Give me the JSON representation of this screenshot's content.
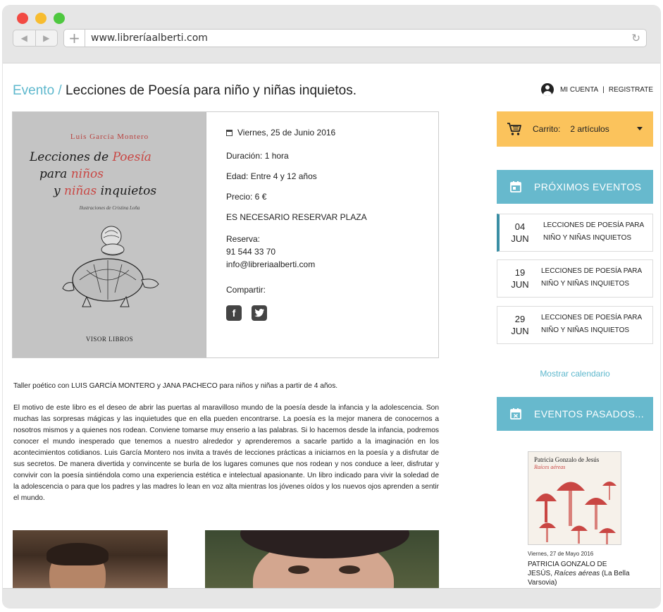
{
  "browser": {
    "url": "www.libreríaalberti.com"
  },
  "header": {
    "crumb": "Evento /",
    "title": "Lecciones de Poesía para niño y niñas inquietos.",
    "account_label": "MI CUENTA",
    "separator": "|",
    "register_label": "REGISTRATE"
  },
  "cover": {
    "author": "Luis García Montero",
    "title_line1_a": "Lecciones de ",
    "title_line1_b": "Poesía",
    "title_line2_a": "para ",
    "title_line2_b": "niños",
    "title_line3_a": "y ",
    "title_line3_b": "niñas",
    "title_line3_c": " inquietos",
    "illustrations": "Ilustraciones de Cristina Loña",
    "publisher": "VISOR LIBROS"
  },
  "event": {
    "date": "Viernes, 25 de Junio 2016",
    "duration": "Duración: 1 hora",
    "age": "Edad: Entre 4 y 12 años",
    "price": "Precio: 6 €",
    "notice": "ES NECESARIO RESERVAR PLAZA",
    "booking_label": "Reserva:",
    "phone": "91 544 33 70",
    "email": "info@libreriaalberti.com",
    "share_label": "Compartir:"
  },
  "body": {
    "intro": "Taller poético  con LUIS GARCÍA MONTERO y JANA PACHECO para niños y niñas a partir de 4 años.",
    "description": "El motivo de este libro es el deseo de abrir las puertas al maravilloso mundo de la poesía desde la infancia y la adolescencia. Son muchas las sorpresas mágicas y las inquietudes que en ella pueden encontrarse. La poesía es la mejor manera de conocernos a nosotros mismos y a quienes nos rodean.  Conviene tomarse muy enserio a las palabras. Si lo hacemos desde la infancia, podremos conocer el mundo inesperado que tenemos a nuestro alrededor y aprenderemos a sacarle partido a la imaginación en los acontecimientos cotidianos. Luis García Montero nos invita a través de lecciones prácticas a iniciarnos en la poesía y a disfrutar de sus secretos. De manera divertida y convincente se burla de los lugares comunes que nos rodean y nos conduce a leer, disfrutar y convivir con la poesía sintiéndola como una experiencia estética e intelectual apasionante. Un libro indicado para vivir la soledad de la adolescencia o para que los padres y las madres lo lean en voz alta mientras los jóvenes oídos y los nuevos ojos aprenden a sentir el mundo."
  },
  "cart": {
    "label": "Carrito:",
    "count": "2 artículos"
  },
  "upcoming": {
    "heading": "PRÓXIMOS EVENTOS",
    "items": [
      {
        "day": "04",
        "month": "JUN",
        "name": "LECCIONES DE POESÍA PARA NIÑO Y NIÑAS INQUIETOS"
      },
      {
        "day": "19",
        "month": "JUN",
        "name": "LECCIONES DE POESÍA PARA NIÑO Y NIÑAS INQUIETOS"
      },
      {
        "day": "29",
        "month": "JUN",
        "name": "LECCIONES DE POESÍA PARA NIÑO Y NIÑAS INQUIETOS"
      }
    ],
    "calendar_link": "Mostrar calendario"
  },
  "past": {
    "heading": "EVENTOS PASADOS...",
    "book_author": "Patricia Gonzalo de Jesús",
    "book_title": "Raíces aéreas",
    "date": "Viernes, 27 de Mayo 2016",
    "name_plain": "PATRICIA GONZALO DE JESÚS, ",
    "name_italic": "Raíces aéreas",
    "name_tail": " (La Bella Varsovia)"
  },
  "colors": {
    "accent": "#5eb8cd",
    "section_header": "#67b9cd",
    "cart": "#fbc35c",
    "active_marker": "#3a8ea4"
  },
  "icons": [
    "back-arrow-icon",
    "forward-arrow-icon",
    "new-tab-icon",
    "reload-icon",
    "user-icon",
    "calendar-icon",
    "cart-icon",
    "caret-down-icon",
    "facebook-icon",
    "twitter-icon",
    "calendar-x-icon"
  ]
}
